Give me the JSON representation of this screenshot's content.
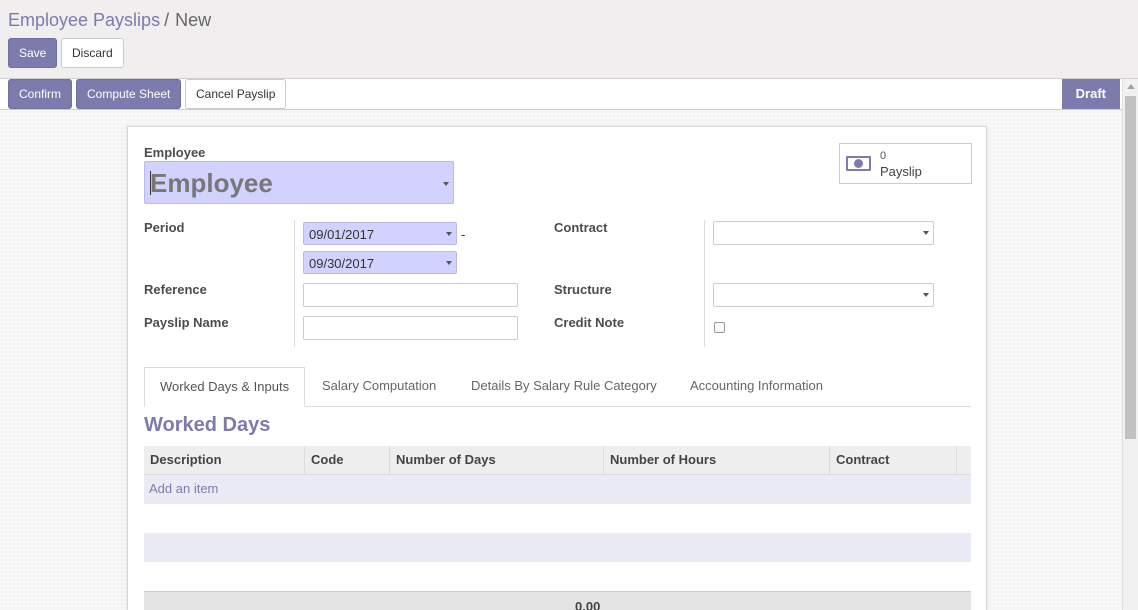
{
  "breadcrumb": {
    "parent": "Employee Payslips",
    "separator": "/",
    "current": "New"
  },
  "control_panel": {
    "save_label": "Save",
    "discard_label": "Discard"
  },
  "statusbar": {
    "buttons": [
      "Confirm",
      "Compute Sheet",
      "Cancel Payslip"
    ],
    "state": "Draft"
  },
  "form": {
    "employee_label": "Employee",
    "employee_placeholder": "Employee",
    "smart_button": {
      "count": "0",
      "label": "Payslip",
      "icon": "money-icon"
    },
    "period_label": "Period",
    "date_from": "09/01/2017",
    "date_separator": "-",
    "date_to": "09/30/2017",
    "reference_label": "Reference",
    "reference_value": "",
    "payslip_name_label": "Payslip Name",
    "payslip_name_value": "",
    "contract_label": "Contract",
    "contract_value": "",
    "structure_label": "Structure",
    "structure_value": "",
    "credit_note_label": "Credit Note",
    "credit_note_checked": false
  },
  "tabs": [
    "Worked Days & Inputs",
    "Salary Computation",
    "Details By Salary Rule Category",
    "Accounting Information"
  ],
  "worked_days": {
    "title": "Worked Days",
    "columns": [
      "Description",
      "Code",
      "Number of Days",
      "Number of Hours",
      "Contract"
    ],
    "add_item": "Add an item",
    "total": "0.00"
  },
  "colors": {
    "accent": "#7c7bad",
    "required_field": "#d2d2ff"
  }
}
